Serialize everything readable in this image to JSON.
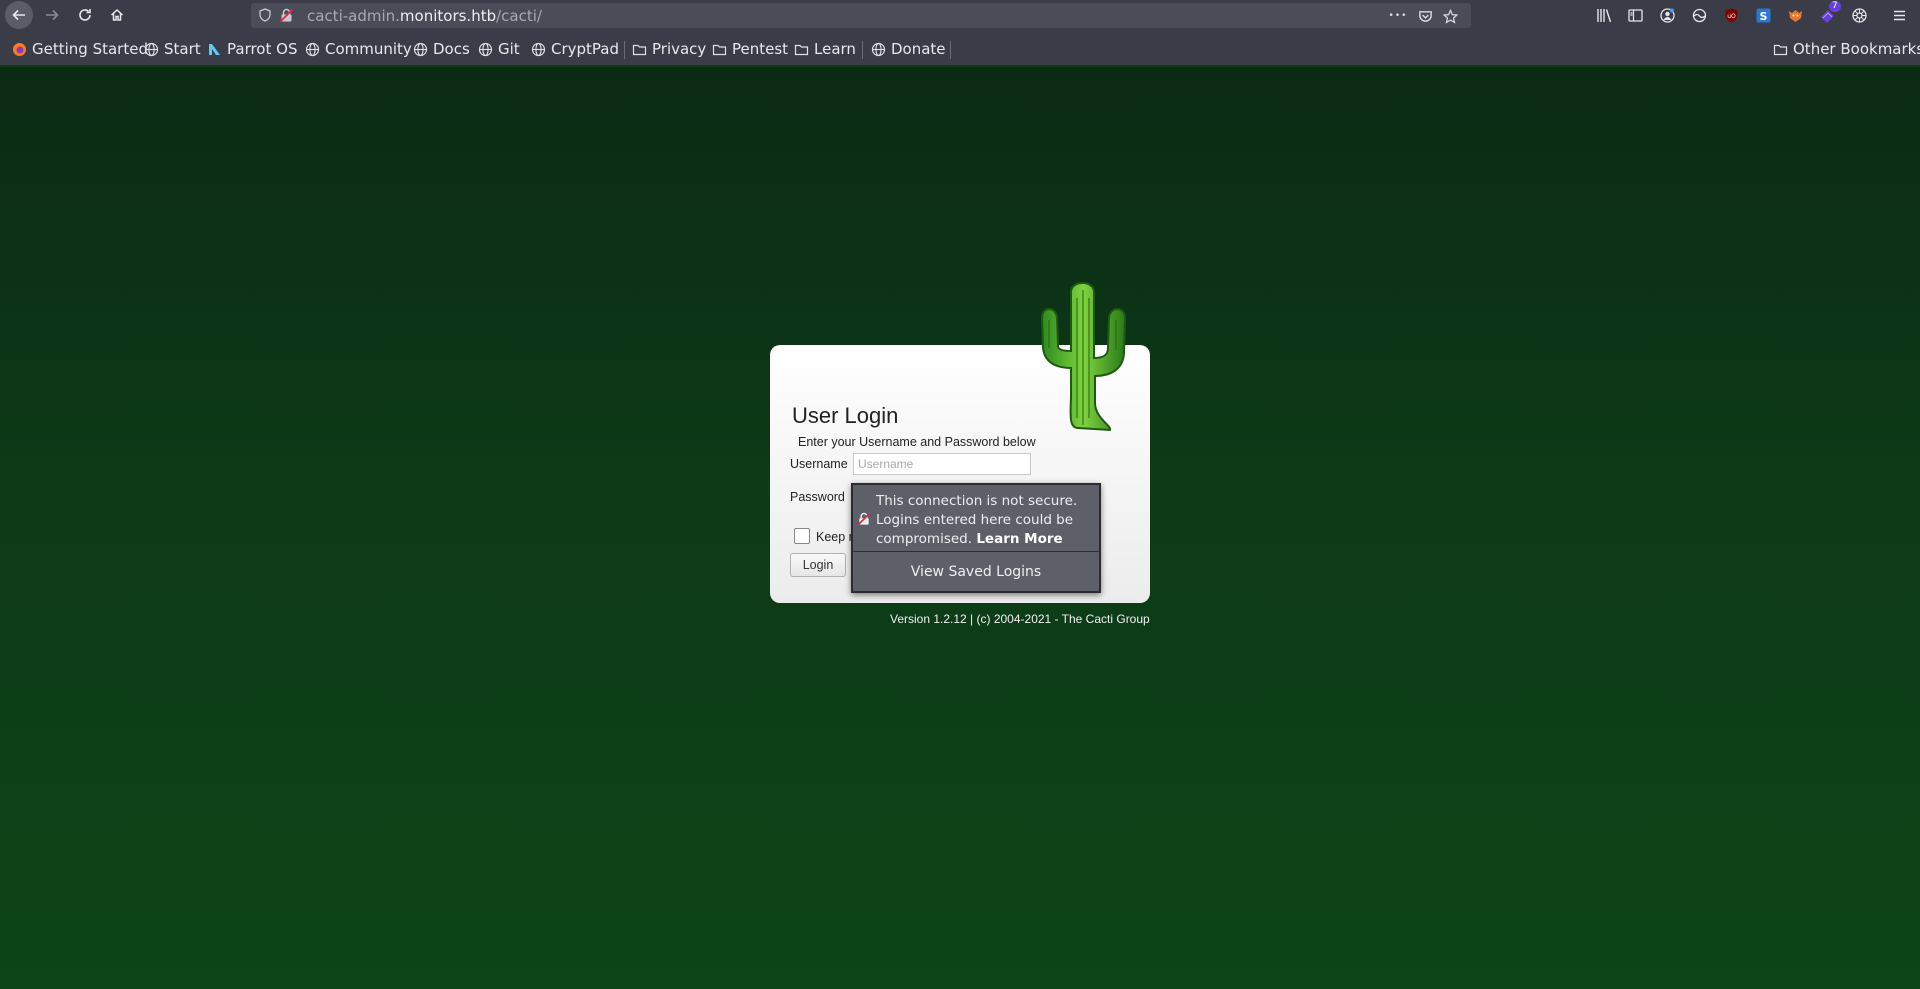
{
  "browser": {
    "url": {
      "prefix": "cacti-admin.",
      "host": "monitors.htb",
      "path": "/cacti/"
    },
    "url_actions": {
      "more": "•••"
    },
    "toolbar_icons": [
      "library-icon",
      "sidebar-icon",
      "account-icon",
      "extension-icon",
      "ublock-icon",
      "extension-s-icon",
      "foxyproxy-icon",
      "extension-badge-icon",
      "settings-icon",
      "menu-icon"
    ],
    "extension_badge": "7"
  },
  "bookmarks": {
    "items": [
      {
        "label": "Getting Started",
        "icon": "firefox-icon"
      },
      {
        "label": "Start",
        "icon": "globe-icon"
      },
      {
        "label": "Parrot OS",
        "icon": "parrot-icon"
      },
      {
        "label": "Community",
        "icon": "globe-icon"
      },
      {
        "label": "Docs",
        "icon": "globe-icon"
      },
      {
        "label": "Git",
        "icon": "globe-icon"
      },
      {
        "label": "CryptPad",
        "icon": "globe-icon"
      },
      {
        "label": "Privacy",
        "icon": "folder-icon"
      },
      {
        "label": "Pentest",
        "icon": "folder-icon"
      },
      {
        "label": "Learn",
        "icon": "folder-icon"
      },
      {
        "label": "Donate",
        "icon": "globe-icon"
      }
    ],
    "other": "Other Bookmarks"
  },
  "login": {
    "title": "User Login",
    "subtitle": "Enter your Username and Password below",
    "username_label": "Username",
    "username_placeholder": "Username",
    "password_label": "Password",
    "keep_label": "Keep m",
    "login_button": "Login"
  },
  "footer": {
    "version": "Version 1.2.12 | (c) 2004-2021 - The Cacti Group"
  },
  "insecure_popup": {
    "message": "This connection is not secure. Logins entered here could be compromised.",
    "learn_more": "Learn More",
    "view_saved": "View Saved Logins"
  },
  "colors": {
    "toolbar": "#3a3d47",
    "page_top": "#0b2a14",
    "page_bottom": "#0d4517",
    "popup": "#5d6068"
  }
}
